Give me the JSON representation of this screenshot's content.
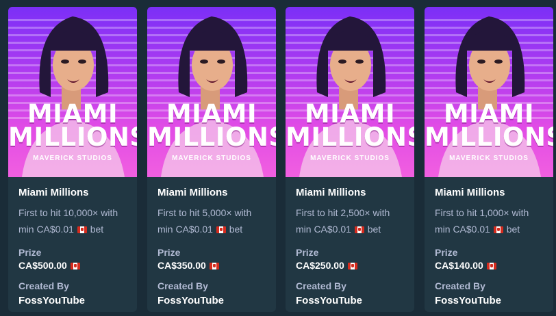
{
  "art": {
    "title_line1": "MIAMI",
    "title_line2": "MILLIONS",
    "studio": "MAVERICK STUDIOS"
  },
  "labels": {
    "prize": "Prize",
    "created_by": "Created By"
  },
  "cards": [
    {
      "game": "Miami Millions",
      "desc_line1": "First to hit 10,000× with",
      "desc_min": "min CA$0.01",
      "desc_bet": "bet",
      "prize": "CA$500.00",
      "creator": "FossYouTube"
    },
    {
      "game": "Miami Millions",
      "desc_line1": "First to hit 5,000× with",
      "desc_min": "min CA$0.01",
      "desc_bet": "bet",
      "prize": "CA$350.00",
      "creator": "FossYouTube"
    },
    {
      "game": "Miami Millions",
      "desc_line1": "First to hit 2,500× with",
      "desc_min": "min CA$0.01",
      "desc_bet": "bet",
      "prize": "CA$250.00",
      "creator": "FossYouTube"
    },
    {
      "game": "Miami Millions",
      "desc_line1": "First to hit 1,000× with",
      "desc_min": "min CA$0.01",
      "desc_bet": "bet",
      "prize": "CA$140.00",
      "creator": "FossYouTube"
    }
  ],
  "icons": {
    "flag": "canada-flag-icon"
  },
  "colors": {
    "background": "#1a2c38",
    "card": "#213743",
    "muted_text": "#b1bad3",
    "art_top": "#7b2ff7",
    "art_bottom": "#f15fe0"
  }
}
